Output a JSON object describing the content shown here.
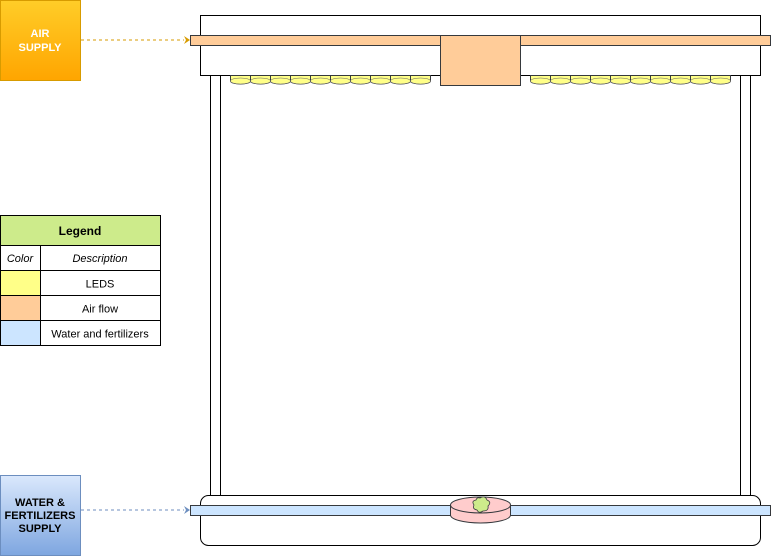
{
  "air_supply": {
    "label_line1": "AIR",
    "label_line2": "SUPPLY"
  },
  "water_supply": {
    "label_line1": "WATER &",
    "label_line2": "FERTILIZERS",
    "label_line3": "SUPPLY"
  },
  "legend": {
    "title": "Legend",
    "col_color": "Color",
    "col_description": "Description",
    "rows": [
      {
        "color": "#ffff88",
        "description": "LEDS"
      },
      {
        "color": "#ffcc99",
        "description": "Air flow"
      },
      {
        "color": "#cce5ff",
        "description": "Water and fertilizers"
      }
    ]
  },
  "colors": {
    "led": "#ffff88",
    "air": "#ffcc99",
    "water": "#cce5ff",
    "dish": "#ffcccc",
    "plant": "#cdeb8b",
    "legend_header": "#cdeb8b"
  }
}
